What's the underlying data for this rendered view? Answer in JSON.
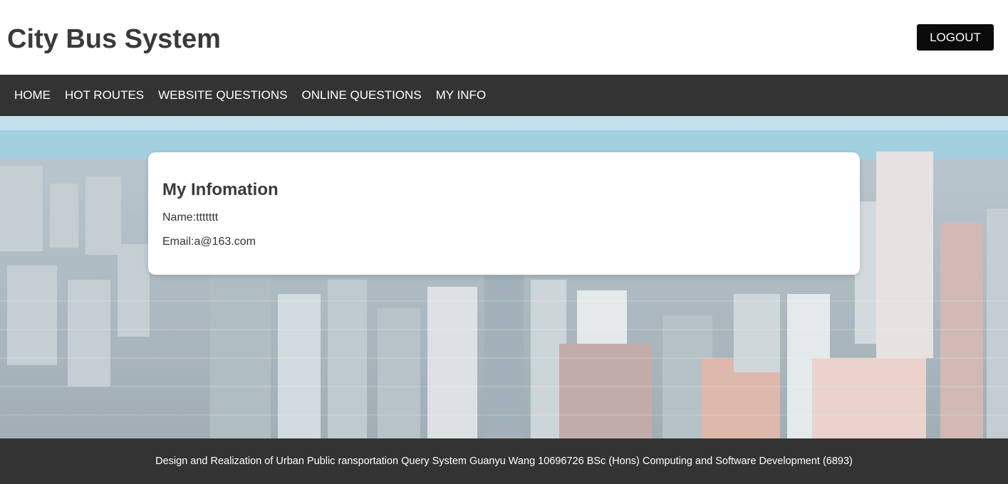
{
  "header": {
    "site_title": "City Bus System",
    "logout_label": "LOGOUT"
  },
  "nav": {
    "items": [
      {
        "label": "HOME"
      },
      {
        "label": "HOT ROUTES"
      },
      {
        "label": "WEBSITE QUESTIONS"
      },
      {
        "label": "ONLINE QUESTIONS"
      },
      {
        "label": "MY INFO"
      }
    ]
  },
  "info": {
    "heading": "My Infomation",
    "name_line": "Name:ttttttt",
    "email_line": "Email:a@163.com"
  },
  "footer": {
    "text": "Design and Realization of Urban Public ransportation Query System Guanyu Wang 10696726 BSc (Hons) Computing and Software Development (6893)"
  },
  "colors": {
    "nav_bg": "#333333",
    "footer_bg": "#333333",
    "button_bg": "#0b0b0b",
    "sky": "#a9d3e3",
    "lake": "#8fc6d8"
  }
}
